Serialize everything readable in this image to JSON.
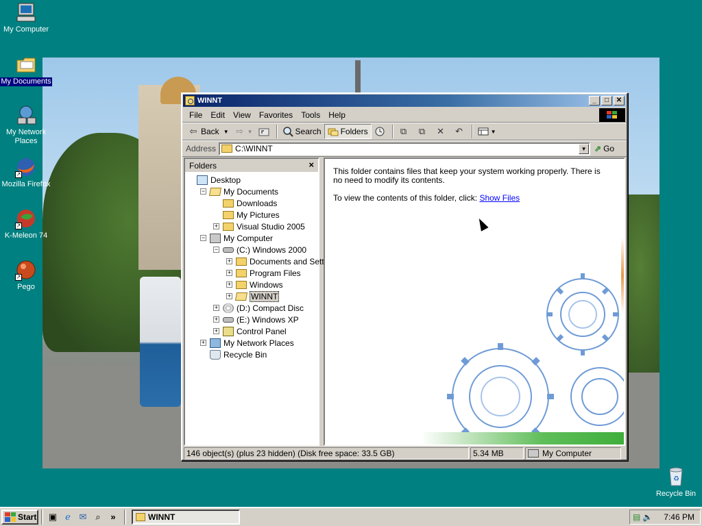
{
  "desktop": {
    "icons": [
      {
        "label": "My Computer",
        "icon": "computer-icon"
      },
      {
        "label": "My Documents",
        "icon": "folder-icon",
        "selected": true
      },
      {
        "label": "My Network Places",
        "icon": "network-icon"
      },
      {
        "label": "Mozilla Firefox",
        "icon": "firefox-icon",
        "shortcut": true
      },
      {
        "label": "K-Meleon 74",
        "icon": "kmeleon-icon",
        "shortcut": true
      },
      {
        "label": "Pego",
        "icon": "pego-icon",
        "shortcut": true
      },
      {
        "label": "Recycle Bin",
        "icon": "recycle-bin-icon"
      }
    ]
  },
  "window": {
    "title": "WINNT",
    "menu": [
      "File",
      "Edit",
      "View",
      "Favorites",
      "Tools",
      "Help"
    ],
    "toolbar": {
      "back": "Back",
      "search": "Search",
      "folders": "Folders"
    },
    "address": {
      "label": "Address",
      "value": "C:\\WINNT",
      "go": "Go"
    },
    "folders_pane": {
      "title": "Folders",
      "tree": [
        {
          "label": "Desktop",
          "icon": "desktop-icon",
          "depth": 0,
          "exp": ""
        },
        {
          "label": "My Documents",
          "icon": "folder-open-icon",
          "depth": 1,
          "exp": "−"
        },
        {
          "label": "Downloads",
          "icon": "folder-icon",
          "depth": 2,
          "exp": ""
        },
        {
          "label": "My Pictures",
          "icon": "pictures-icon",
          "depth": 2,
          "exp": ""
        },
        {
          "label": "Visual Studio 2005",
          "icon": "folder-icon",
          "depth": 2,
          "exp": "+"
        },
        {
          "label": "My Computer",
          "icon": "computer-icon",
          "depth": 1,
          "exp": "−"
        },
        {
          "label": "(C:) Windows 2000",
          "icon": "drive-icon",
          "depth": 2,
          "exp": "−"
        },
        {
          "label": "Documents and Settings",
          "icon": "folder-icon",
          "depth": 3,
          "exp": "+"
        },
        {
          "label": "Program Files",
          "icon": "folder-icon",
          "depth": 3,
          "exp": "+"
        },
        {
          "label": "Windows",
          "icon": "folder-icon",
          "depth": 3,
          "exp": "+"
        },
        {
          "label": "WINNT",
          "icon": "folder-open-icon",
          "depth": 3,
          "exp": "+",
          "selected": true
        },
        {
          "label": "(D:) Compact Disc",
          "icon": "cd-icon",
          "depth": 2,
          "exp": "+"
        },
        {
          "label": "(E:) Windows XP",
          "icon": "drive-icon",
          "depth": 2,
          "exp": "+"
        },
        {
          "label": "Control Panel",
          "icon": "control-panel-icon",
          "depth": 2,
          "exp": "+"
        },
        {
          "label": "My Network Places",
          "icon": "network-icon",
          "depth": 1,
          "exp": "+"
        },
        {
          "label": "Recycle Bin",
          "icon": "recycle-bin-icon",
          "depth": 1,
          "exp": ""
        }
      ]
    },
    "main": {
      "message1": "This folder contains files that keep your system working properly. There is no need to modify its contents.",
      "message2": "To view the contents of this folder, click:",
      "show_files": "Show Files"
    },
    "status": {
      "objects": "146 object(s) (plus 23 hidden) (Disk free space: 33.5 GB)",
      "size": "5.34 MB",
      "zone": "My Computer"
    }
  },
  "taskbar": {
    "start": "Start",
    "task": "WINNT",
    "quicklaunch_more": "»",
    "clock": "7:46 PM"
  }
}
